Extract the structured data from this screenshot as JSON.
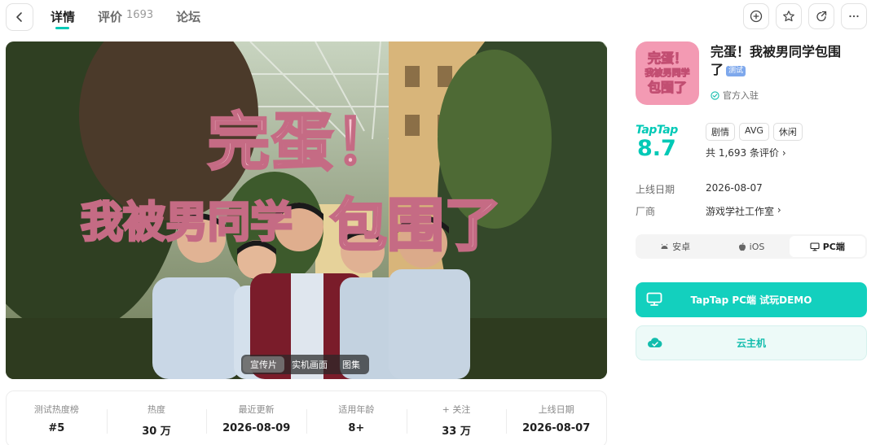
{
  "header": {
    "tabs": [
      {
        "label": "详情"
      },
      {
        "label": "评价",
        "count": "1693"
      },
      {
        "label": "论坛"
      }
    ]
  },
  "banner": {
    "title_line1": "完蛋！",
    "title_line2_a": "我被男同学",
    "title_line2_b": "包围了",
    "media_tabs": [
      "宣传片",
      "实机画面",
      "图集"
    ],
    "active_media_tab": 0
  },
  "stats": [
    {
      "label": "测试热度榜",
      "value": "#5"
    },
    {
      "label": "热度",
      "value": "30 万"
    },
    {
      "label": "最近更新",
      "value": "2026-08-09"
    },
    {
      "label": "适用年龄",
      "value": "8+"
    },
    {
      "label": "+ 关注",
      "value": "33 万"
    },
    {
      "label": "上线日期",
      "value": "2026-08-07"
    }
  ],
  "app": {
    "icon_text": [
      "完蛋！",
      "我被男同学",
      "包围了"
    ],
    "name": "完蛋！我被男同学包围了",
    "test_badge": "测试",
    "official": "官方入驻",
    "rating_brand": "TapTap",
    "score": "8.7",
    "tags": [
      "剧情",
      "AVG",
      "休闲"
    ],
    "review_count": "共 1,693 条评价",
    "release_label": "上线日期",
    "release_value": "2026-08-07",
    "vendor_label": "厂商",
    "vendor_value": "游戏学社工作室"
  },
  "platforms": [
    {
      "label": "安卓",
      "icon": "android-icon"
    },
    {
      "label": "iOS",
      "icon": "apple-icon"
    },
    {
      "label": "PC端",
      "icon": "monitor-icon"
    }
  ],
  "active_platform": 2,
  "buttons": {
    "demo": "TapTap PC端 试玩DEMO",
    "cloud": "云主机"
  },
  "colors": {
    "accent": "#13d0be",
    "brand_pink": "#f39ab3"
  }
}
